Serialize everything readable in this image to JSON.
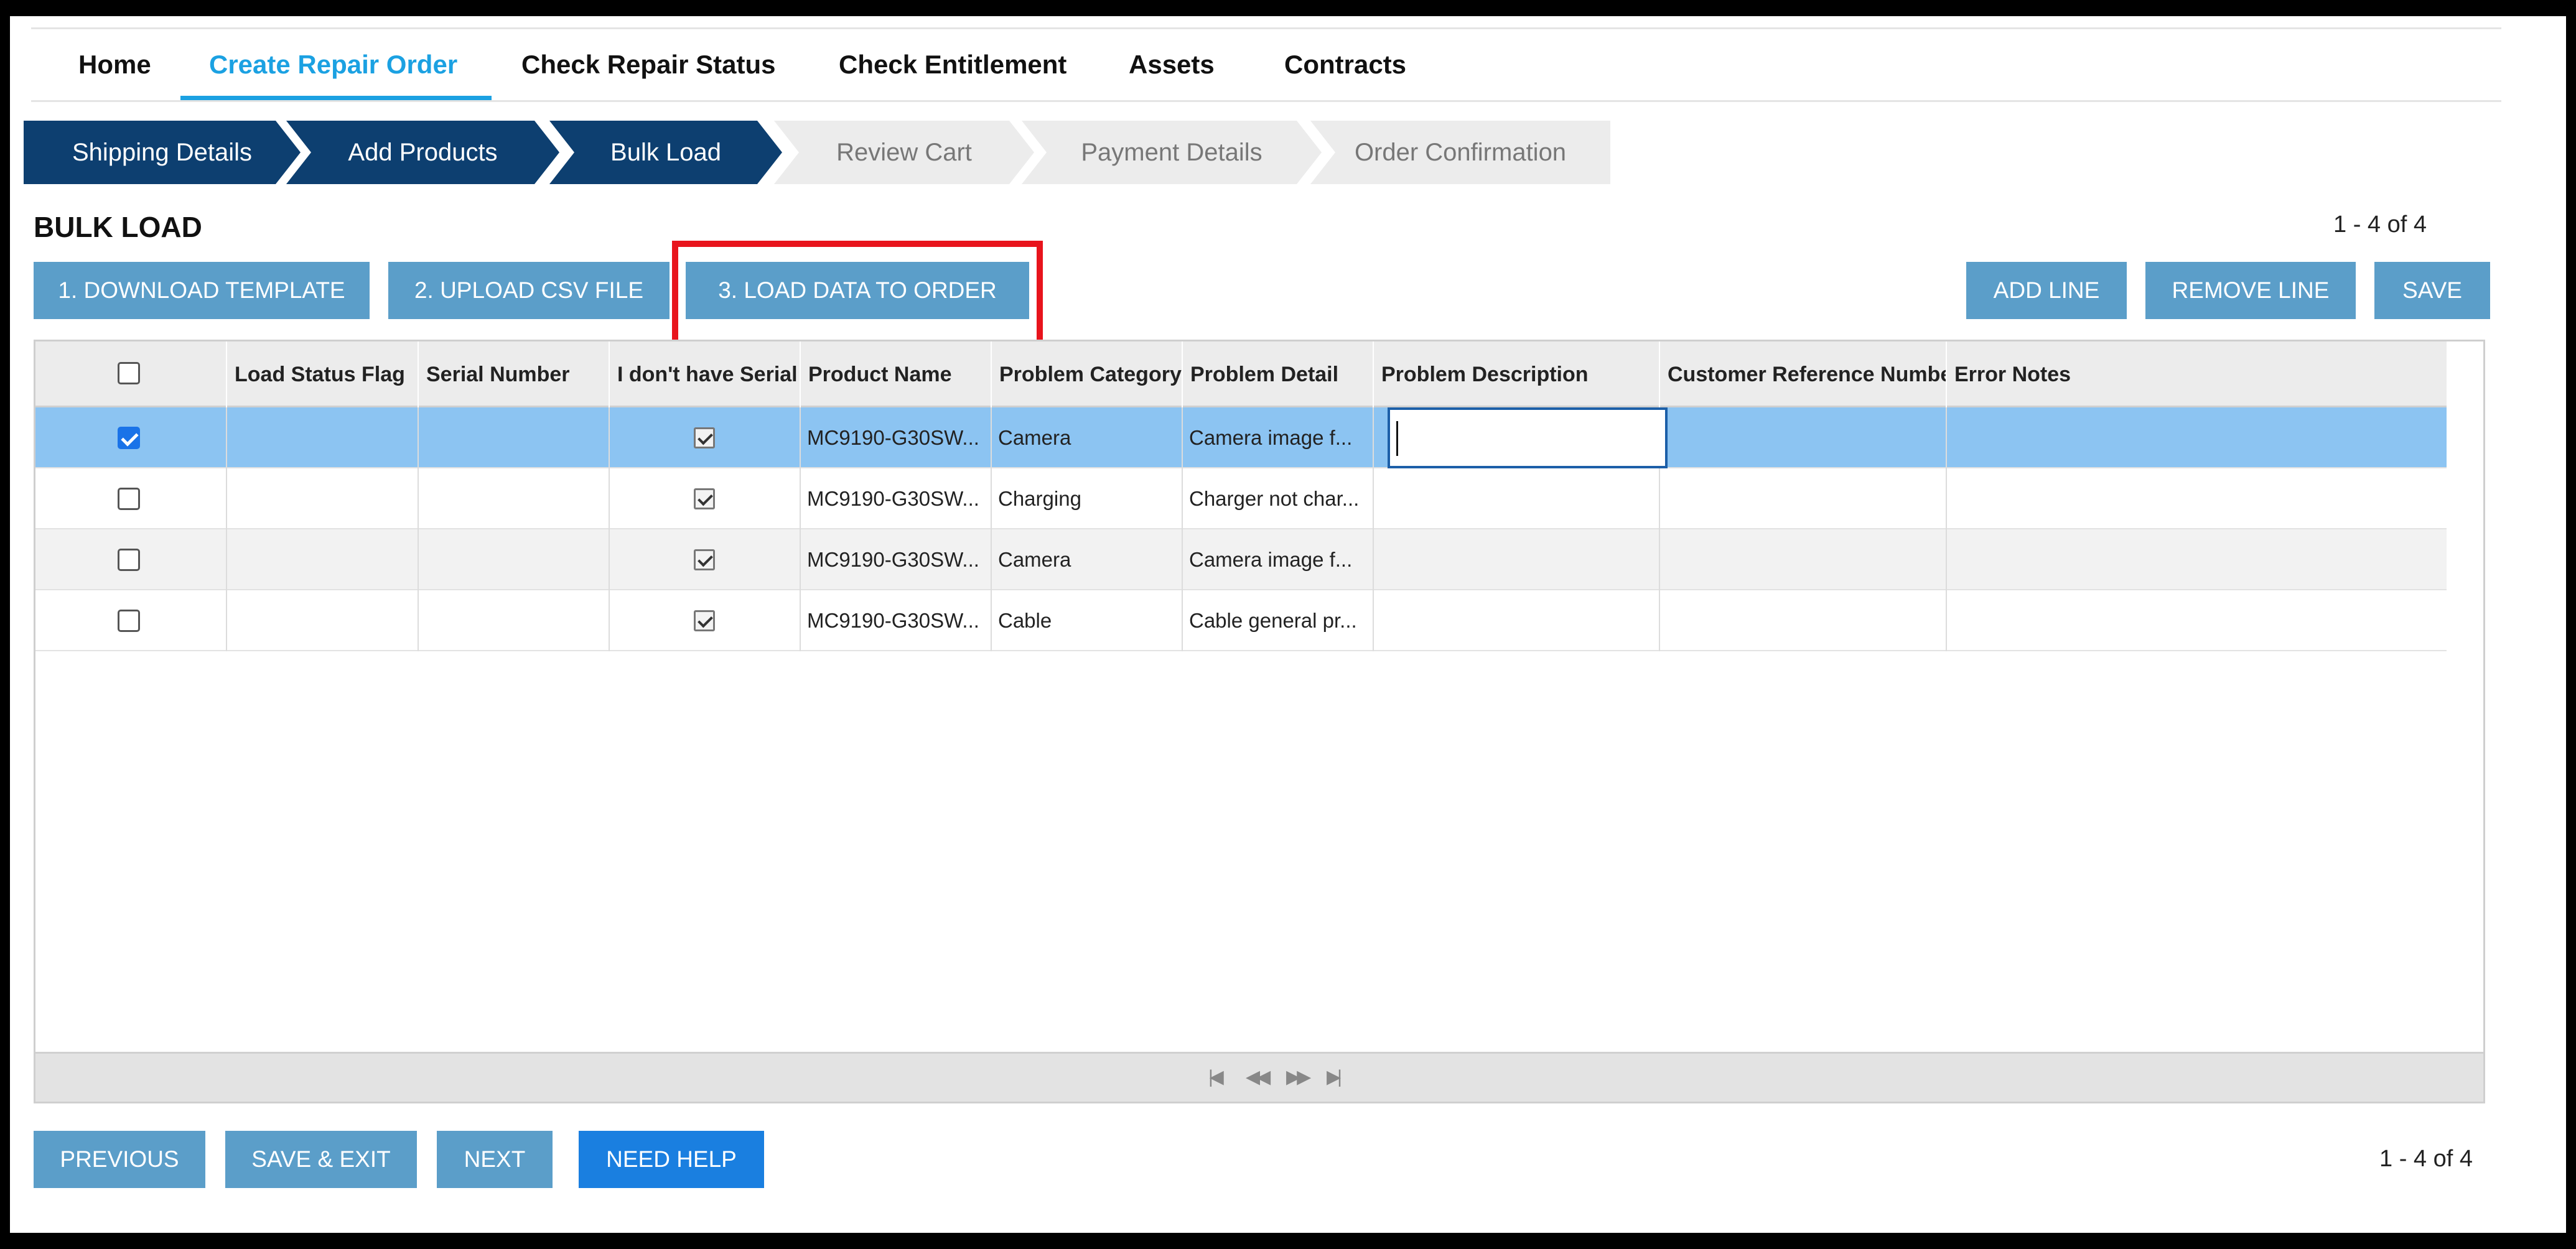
{
  "nav": {
    "items": [
      "Home",
      "Create Repair Order",
      "Check Repair Status",
      "Check Entitlement",
      "Assets",
      "Contracts"
    ],
    "active": "Create Repair Order"
  },
  "steps": [
    "Shipping Details",
    "Add Products",
    "Bulk Load",
    "Review Cart",
    "Payment Details",
    "Order Confirmation"
  ],
  "section": {
    "title": "BULK LOAD",
    "pager_top": "1 - 4 of 4",
    "pager_bottom": "1 - 4 of 4"
  },
  "toolbar": {
    "download_template": "1. DOWNLOAD TEMPLATE",
    "upload_csv": "2. UPLOAD CSV FILE",
    "load_data": "3. LOAD DATA TO ORDER",
    "add_line": "ADD LINE",
    "remove_line": "REMOVE LINE",
    "save": "SAVE"
  },
  "grid": {
    "columns": [
      "",
      "Load Status Flag",
      "Serial Number",
      "I don't have Serial",
      "Product Name",
      "Problem Category",
      "Problem Detail",
      "Problem Description",
      "Customer Reference Number",
      "Error Notes"
    ],
    "rows": [
      {
        "selected": true,
        "no_serial": true,
        "product": "MC9190-G30SW...",
        "category": "Camera",
        "detail": "Camera image f...",
        "description": "",
        "customer_ref": "",
        "error_notes": ""
      },
      {
        "selected": false,
        "no_serial": true,
        "product": "MC9190-G30SW...",
        "category": "Charging",
        "detail": "Charger not char...",
        "description": "",
        "customer_ref": "",
        "error_notes": ""
      },
      {
        "selected": false,
        "no_serial": true,
        "product": "MC9190-G30SW...",
        "category": "Camera",
        "detail": "Camera image f...",
        "description": "",
        "customer_ref": "",
        "error_notes": ""
      },
      {
        "selected": false,
        "no_serial": true,
        "product": "MC9190-G30SW...",
        "category": "Cable",
        "detail": "Cable general pr...",
        "description": "",
        "customer_ref": "",
        "error_notes": ""
      }
    ],
    "pager_icons": [
      "first-page-icon",
      "prev-page-icon",
      "next-page-icon",
      "last-page-icon"
    ]
  },
  "footer": {
    "previous": "PREVIOUS",
    "save_exit": "SAVE & EXIT",
    "next": "NEXT",
    "need_help": "NEED HELP"
  },
  "colors": {
    "accent": "#1ba1e2",
    "step_done": "#0d3f70",
    "button": "#5b9ec9",
    "button_primary": "#1a7fe0",
    "selected_row": "#8cc4f2",
    "highlight": "#e8141c"
  }
}
